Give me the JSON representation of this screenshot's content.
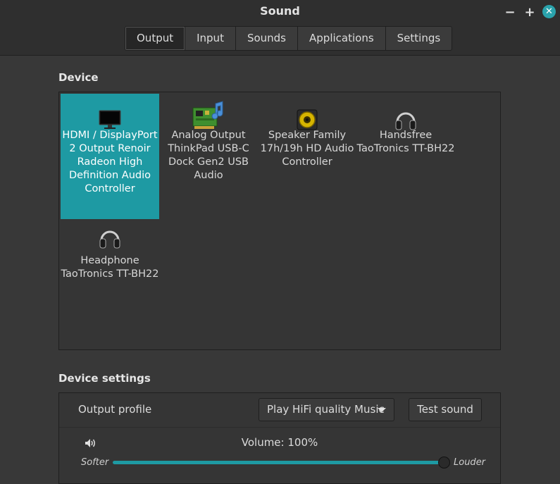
{
  "window": {
    "title": "Sound"
  },
  "tabs": [
    {
      "label": "Output",
      "active": true
    },
    {
      "label": "Input",
      "active": false
    },
    {
      "label": "Sounds",
      "active": false
    },
    {
      "label": "Applications",
      "active": false
    },
    {
      "label": "Settings",
      "active": false
    }
  ],
  "device_section": {
    "title": "Device",
    "devices": [
      {
        "label": "HDMI / DisplayPort 2 Output Renoir Radeon High Definition Audio Controller",
        "icon": "monitor-icon",
        "selected": true
      },
      {
        "label": "Analog Output ThinkPad USB-C Dock Gen2 USB Audio",
        "icon": "sound-card-icon",
        "selected": false
      },
      {
        "label": "Speaker Family 17h/19h HD Audio Controller",
        "icon": "speaker-icon",
        "selected": false
      },
      {
        "label": "Handsfree TaoTronics TT-BH22",
        "icon": "headphones-icon",
        "selected": false
      },
      {
        "label": "Headphone TaoTronics TT-BH22",
        "icon": "headphones-icon",
        "selected": false
      }
    ]
  },
  "device_settings": {
    "title": "Device settings",
    "output_profile_label": "Output profile",
    "output_profile_value": "Play HiFi quality Music",
    "test_sound_label": "Test sound",
    "volume_label": "Volume: 100%",
    "volume_fraction": 1.0,
    "softer_label": "Softer",
    "louder_label": "Louder",
    "volume_icon": "speaker-volume-icon"
  },
  "colors": {
    "accent": "#1e9aa3",
    "background": "#383838",
    "titlebar": "#2f2f2f"
  }
}
